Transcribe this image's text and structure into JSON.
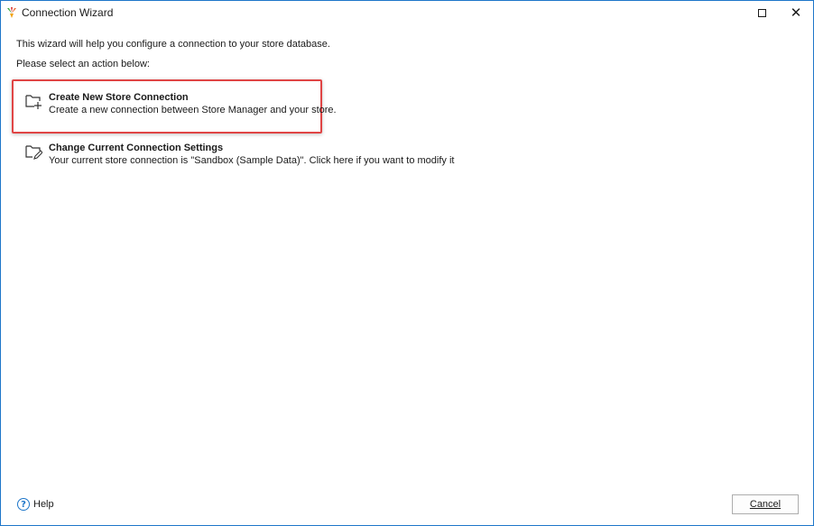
{
  "window": {
    "title": "Connection Wizard",
    "app_icon": "store-manager-logo-icon",
    "maximize_icon": "maximize-icon",
    "close_icon": "close-icon",
    "close_glyph": "✕"
  },
  "intro_text": "This wizard will help you configure a connection to your store database.",
  "prompt_text": "Please select an action below:",
  "options": [
    {
      "title": "Create New Store Connection",
      "description": "Create a new connection between Store Manager and your store.",
      "icon": "folder-add-icon",
      "highlighted": true
    },
    {
      "title": "Change Current Connection Settings",
      "description": "Your current store connection is \"Sandbox (Sample Data)\". Click here if you want to modify it",
      "icon": "folder-edit-icon",
      "highlighted": false
    }
  ],
  "footer": {
    "help_label": "Help",
    "help_glyph": "?",
    "cancel_label": "Cancel"
  },
  "colors": {
    "window_border": "#1e76c9",
    "highlight": "#e04545",
    "help_icon": "#1e76c9"
  }
}
